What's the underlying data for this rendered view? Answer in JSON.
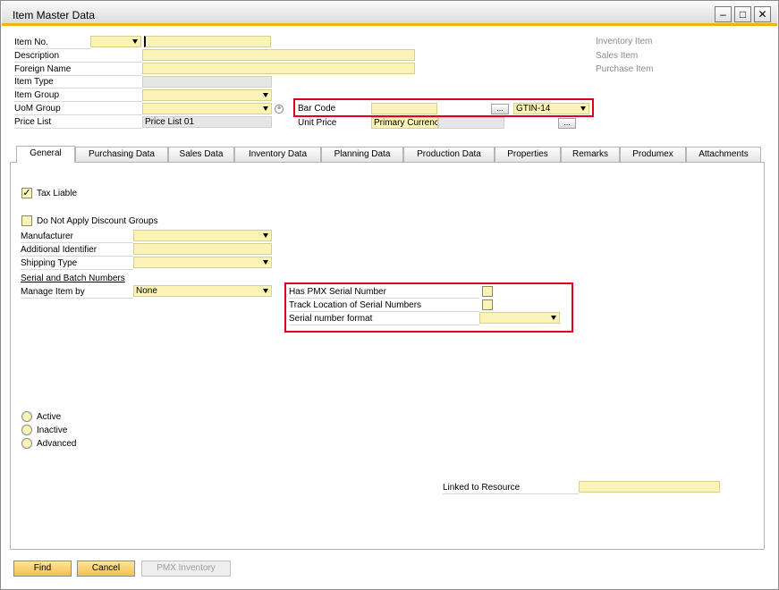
{
  "window": {
    "title": "Item Master Data",
    "controls": [
      "minimize",
      "maximize",
      "close"
    ]
  },
  "header": {
    "item_no_label": "Item No.",
    "description_label": "Description",
    "foreign_name_label": "Foreign Name",
    "item_type_label": "Item Type",
    "item_group_label": "Item Group",
    "uom_group_label": "UoM Group",
    "price_list_label": "Price List",
    "price_list_value": "Price List 01",
    "bar_code_label": "Bar Code",
    "barcode_type_value": "GTIN-14",
    "unit_price_label": "Unit Price",
    "unit_price_currency": "Primary Currenc",
    "dots_label": "...",
    "inventory_item": "Inventory Item",
    "sales_item": "Sales Item",
    "purchase_item": "Purchase Item"
  },
  "tabs": [
    {
      "label": "General",
      "active": true
    },
    {
      "label": "Purchasing Data"
    },
    {
      "label": "Sales Data"
    },
    {
      "label": "Inventory Data"
    },
    {
      "label": "Planning Data"
    },
    {
      "label": "Production Data"
    },
    {
      "label": "Properties"
    },
    {
      "label": "Remarks"
    },
    {
      "label": "Produmex"
    },
    {
      "label": "Attachments"
    }
  ],
  "general": {
    "tax_liable_label": "Tax Liable",
    "tax_liable_checked": true,
    "check_mark": "✓",
    "no_discount_label": "Do Not Apply Discount Groups",
    "manufacturer_label": "Manufacturer",
    "additional_identifier_label": "Additional Identifier",
    "shipping_type_label": "Shipping Type",
    "serial_batch_label": "Serial and Batch Numbers",
    "manage_item_by_label": "Manage Item by",
    "manage_item_by_value": "None",
    "pmx_serial_label": "Has PMX Serial Number",
    "track_location_label": "Track Location of Serial Numbers",
    "serial_format_label": "Serial number format",
    "status_active": "Active",
    "status_inactive": "Inactive",
    "status_advanced": "Advanced",
    "linked_resource_label": "Linked to Resource"
  },
  "footer": {
    "find_label": "Find",
    "cancel_label": "Cancel",
    "pmx_inventory_label": "PMX Inventory"
  },
  "colors": {
    "field_yellow": "#fbf4b6",
    "accent_orange": "#f0b400",
    "highlight_red": "#e0001b"
  }
}
